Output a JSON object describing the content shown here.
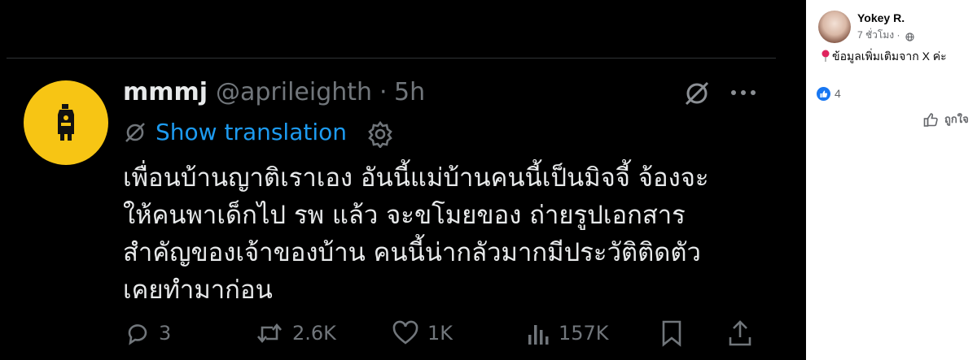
{
  "tweet": {
    "display_name": "mmmj",
    "handle": "@aprileighth",
    "separator": "·",
    "time": "5h",
    "show_translation": "Show translation",
    "text_lines": [
      "เพื่อนบ้านญาติเราเอง อันนี้แม่บ้านคนนี้เป็นมิจจี้ จ้องจะ",
      "ให้คนพาเด็กไป รพ แล้ว จะขโมยของ ถ่ายรูปเอกสาร",
      "สำคัญของเจ้าของบ้าน คนนี้น่ากลัวมากมีประวัติติดตัว",
      "เคยทำมาก่อน"
    ],
    "actions": {
      "replies": "3",
      "reposts": "2.6K",
      "likes": "1K",
      "views": "157K"
    },
    "colors": {
      "background": "#000000",
      "link": "#1d9bf0",
      "muted": "#71767b",
      "avatar": "#f7c514"
    }
  },
  "post": {
    "author": "Yokey R.",
    "time": "7 ชั่วโมง ·",
    "caption": "ข้อมูลเพิ่มเติมจาก X ค่ะ",
    "reaction_count": "4",
    "like_label": "ถูกใจ",
    "colors": {
      "accent": "#1877f2"
    }
  }
}
